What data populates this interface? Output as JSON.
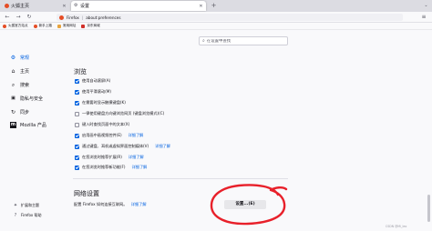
{
  "tabs": [
    {
      "title": "火狐主页",
      "active": false
    },
    {
      "title": "设置",
      "active": true
    }
  ],
  "navbar": {
    "back_glyph": "←",
    "forward_glyph": "→",
    "reload_glyph": "↻",
    "url_brand": "Firefox",
    "url_path": "about:preferences",
    "menu_glyph": "≡"
  },
  "bookmarks": [
    {
      "label": "火狐官方站点",
      "color": "#e54d26"
    },
    {
      "label": "新手上路",
      "color": "#e54d26"
    },
    {
      "label": "常用网址",
      "color": "#e7a33e"
    },
    {
      "label": "京东商城",
      "color": "#d1302a"
    }
  ],
  "sidebar": {
    "items": [
      {
        "label": "常规",
        "icon": "gear-icon",
        "glyph": "⚙",
        "selected": true
      },
      {
        "label": "主页",
        "icon": "home-icon",
        "glyph": "⌂",
        "selected": false
      },
      {
        "label": "搜索",
        "icon": "search-icon",
        "glyph": "⌕",
        "selected": false
      },
      {
        "label": "隐私与安全",
        "icon": "lock-icon",
        "glyph": "🔒",
        "selected": false
      },
      {
        "label": "同步",
        "icon": "sync-icon",
        "glyph": "↻",
        "selected": false
      },
      {
        "label": "Mozilla 产品",
        "icon": "mozilla-icon",
        "glyph": "m",
        "selected": false
      }
    ],
    "bottom": [
      {
        "label": "扩展和主题",
        "icon": "puzzle-icon",
        "glyph": "✦"
      },
      {
        "label": "Firefox 帮助",
        "icon": "help-icon",
        "glyph": "?"
      }
    ]
  },
  "search": {
    "placeholder": "在设置中查找"
  },
  "browsing": {
    "title": "浏览",
    "options": [
      {
        "label": "使用自动滚屏(A)",
        "checked": true,
        "learn": ""
      },
      {
        "label": "使用平滑滚动(M)",
        "checked": true,
        "learn": ""
      },
      {
        "label": "在需要时显示触摸键盘(K)",
        "checked": true,
        "learn": ""
      },
      {
        "label": "一律使用键盘方向键浏览网页 (键盘浏览模式)(C)",
        "checked": false,
        "learn": ""
      },
      {
        "label": "键入时查找页面中的文本(X)",
        "checked": false,
        "learn": ""
      },
      {
        "label": "启用画中画视频控件(E)",
        "checked": true,
        "learn": "详细了解"
      },
      {
        "label": "通过键盘、耳机或虚拟界面控制媒体(V)",
        "checked": true,
        "learn": "详细了解"
      },
      {
        "label": "在您浏览时推荐扩展(R)",
        "checked": true,
        "learn": "详细了解"
      },
      {
        "label": "在您浏览时推荐新功能(F)",
        "checked": true,
        "learn": "详细了解"
      }
    ]
  },
  "network": {
    "title": "网络设置",
    "description": "配置 Firefox 如何连接互联网。",
    "learn": "详细了解",
    "button": "设置...(E)"
  },
  "annotation": {
    "color": "#e8202a"
  },
  "watermark": "CSDN @Mi_leo"
}
